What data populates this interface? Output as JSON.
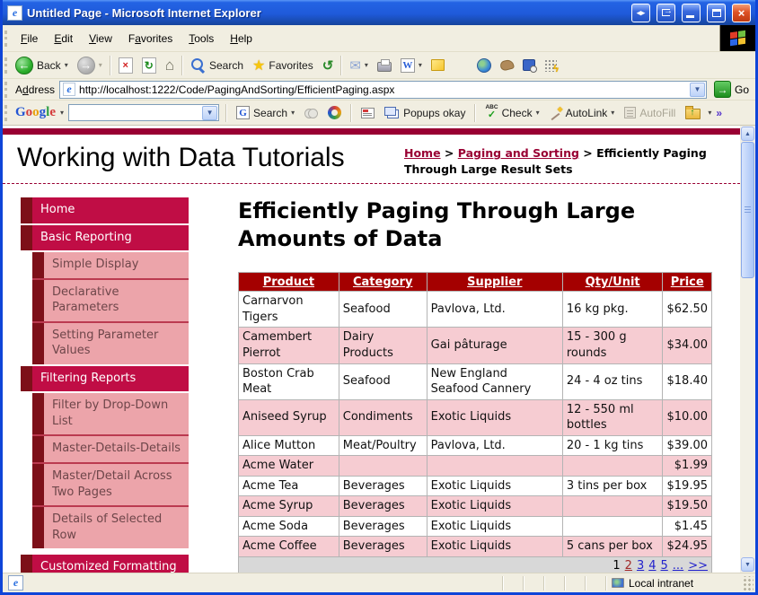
{
  "chrome": {
    "title": "Untitled Page - Microsoft Internet Explorer",
    "menus": [
      {
        "label": "File",
        "key": "F"
      },
      {
        "label": "Edit",
        "key": "E"
      },
      {
        "label": "View",
        "key": "V"
      },
      {
        "label": "Favorites",
        "key": "a"
      },
      {
        "label": "Tools",
        "key": "T"
      },
      {
        "label": "Help",
        "key": "H"
      }
    ],
    "toolbar": {
      "back_label": "Back",
      "search_label": "Search",
      "favorites_label": "Favorites"
    },
    "address": {
      "label": "Address",
      "value": "http://localhost:1222/Code/PagingAndSorting/EfficientPaging.aspx",
      "go_label": "Go"
    },
    "google": {
      "logo_letters": [
        "G",
        "o",
        "o",
        "g",
        "l",
        "e"
      ],
      "search_label": "Search",
      "popups_label": "Popups okay",
      "check_abc": "ABC",
      "check_label": "Check",
      "autolink_label": "AutoLink",
      "autofill_label": "AutoFill",
      "more_label": "»"
    },
    "status": {
      "zone_label": "Local intranet"
    },
    "icons": {
      "back": "green-circle-left-arrow",
      "forward": "gray-circle-right-arrow",
      "stop": "page-red-x",
      "refresh": "page-green-arrows",
      "home": "house",
      "search": "magnifier",
      "favorites": "gold-star",
      "history": "green-clock-arrow",
      "mail": "envelope",
      "print": "printer",
      "edit": "word-document",
      "note": "yellow-note",
      "go": "green-arrow-box",
      "throbber": "windows-flag",
      "zone": "monitor-globe"
    }
  },
  "page": {
    "site_title": "Working with Data Tutorials",
    "breadcrumb": [
      {
        "label": "Home",
        "type": "link"
      },
      {
        "label": "Paging and Sorting",
        "type": "link"
      },
      {
        "label": "Efficiently Paging Through Large Result Sets",
        "type": "text"
      }
    ],
    "sidebar": [
      {
        "label": "Home",
        "level": 1
      },
      {
        "label": "Basic Reporting",
        "level": 1
      },
      {
        "label": "Simple Display",
        "level": 2
      },
      {
        "label": "Declarative Parameters",
        "level": 2
      },
      {
        "label": "Setting Parameter Values",
        "level": 2
      },
      {
        "label": "Filtering Reports",
        "level": 1
      },
      {
        "label": "Filter by Drop-Down List",
        "level": 2
      },
      {
        "label": "Master-Details-Details",
        "level": 2
      },
      {
        "label": "Master/Detail Across Two Pages",
        "level": 2
      },
      {
        "label": "Details of Selected Row",
        "level": 2
      },
      {
        "label": "Customized Formatting",
        "level": 1,
        "gap": true
      }
    ],
    "heading": "Efficiently Paging Through Large Amounts of Data",
    "grid": {
      "columns": [
        "Product",
        "Category",
        "Supplier",
        "Qty/Unit",
        "Price"
      ],
      "rows": [
        [
          "Carnarvon Tigers",
          "Seafood",
          "Pavlova, Ltd.",
          "16 kg pkg.",
          "$62.50"
        ],
        [
          "Camembert Pierrot",
          "Dairy Products",
          "Gai pâturage",
          "15 - 300 g rounds",
          "$34.00"
        ],
        [
          "Boston Crab Meat",
          "Seafood",
          "New England Seafood Cannery",
          "24 - 4 oz tins",
          "$18.40"
        ],
        [
          "Aniseed Syrup",
          "Condiments",
          "Exotic Liquids",
          "12 - 550 ml bottles",
          "$10.00"
        ],
        [
          "Alice Mutton",
          "Meat/Poultry",
          "Pavlova, Ltd.",
          "20 - 1 kg tins",
          "$39.00"
        ],
        [
          "Acme Water",
          "",
          "",
          "",
          "$1.99"
        ],
        [
          "Acme Tea",
          "Beverages",
          "Exotic Liquids",
          "3 tins per box",
          "$19.95"
        ],
        [
          "Acme Syrup",
          "Beverages",
          "Exotic Liquids",
          "",
          "$19.50"
        ],
        [
          "Acme Soda",
          "Beverages",
          "Exotic Liquids",
          "",
          "$1.45"
        ],
        [
          "Acme Coffee",
          "Beverages",
          "Exotic Liquids",
          "5 cans per box",
          "$24.95"
        ]
      ],
      "pager": [
        {
          "label": "1",
          "state": "current"
        },
        {
          "label": "2",
          "state": "visited"
        },
        {
          "label": "3",
          "state": "link"
        },
        {
          "label": "4",
          "state": "link"
        },
        {
          "label": "5",
          "state": "link"
        },
        {
          "label": "...",
          "state": "link"
        },
        {
          "label": ">>",
          "state": "link"
        }
      ]
    }
  },
  "colors": {
    "crimson": "#c00d45",
    "maroon_accent": "#7d1019",
    "sidebar_pink": "#eca4aa",
    "table_header_red": "#a40000",
    "table_alt_pink": "#f6ccd2",
    "link_red": "#990033",
    "pager_bg": "#d8d8d8",
    "xp_titlebar_blue": "#1f5ada",
    "xp_chrome_beige": "#f1eee1"
  }
}
